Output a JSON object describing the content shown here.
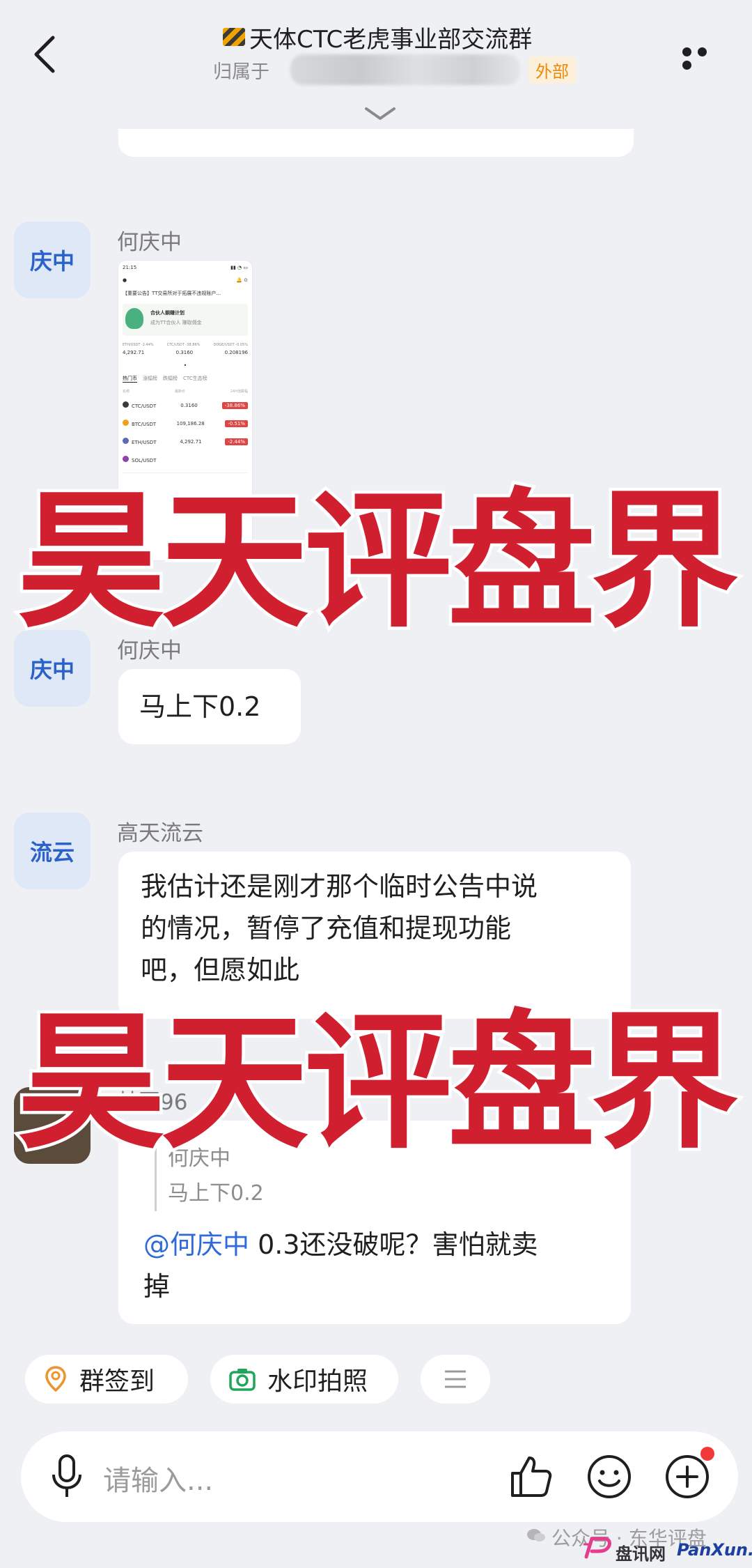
{
  "header": {
    "title": "天体CTC老虎事业部交流群",
    "belong_label": "归属于",
    "external_badge": "外部"
  },
  "messages": [
    {
      "avatar": "庆中",
      "sender": "何庆中",
      "type": "image"
    },
    {
      "avatar": "庆中",
      "sender": "何庆中",
      "text": "马上下0.2"
    },
    {
      "avatar": "流云",
      "sender": "高天流云",
      "lines": [
        "我估计还是刚才那个临时公告中说",
        "的情况，暂停了充值和提现功能",
        "吧，但愿如此"
      ]
    },
    {
      "sender": "林圆96",
      "quote_author": "何庆中",
      "quote_text": "马上下0.2",
      "mention": "@何庆中",
      "lines": [
        " 0.3还没破呢？害怕就卖",
        "掉"
      ]
    }
  ],
  "screenshot": {
    "time": "21:15",
    "notice": "【重要公告】TT交易所对于拓展不违规账户...",
    "banner_title": "合伙人躺赚计划",
    "banner_sub": "成为TT合伙人 赚取佣金",
    "tickers": [
      {
        "pair": "ETH/USDT -2.44%",
        "price": "4,292.71"
      },
      {
        "pair": "CTC/USDT -38.86%",
        "price": "0.3160"
      },
      {
        "pair": "DOGE/USDT -0.05%",
        "price": "0.208196"
      }
    ],
    "tabs": [
      "热门币",
      "涨幅榜",
      "跌幅榜",
      "CTC生态榜"
    ],
    "columns": [
      "名称",
      "最新价",
      "24H涨跌幅"
    ],
    "coins": [
      {
        "name": "CTC/USDT",
        "price": "0.3160",
        "change": "-38.86%",
        "color": "#3a3a3a"
      },
      {
        "name": "BTC/USDT",
        "price": "109,186.28",
        "change": "-0.51%",
        "color": "#f2a01c"
      },
      {
        "name": "ETH/USDT",
        "price": "4,292.71",
        "change": "-2.44%",
        "color": "#5b6bb5"
      },
      {
        "name": "SOL/USDT",
        "price": "",
        "change": "",
        "color": "#8e44ad"
      }
    ]
  },
  "watermark": "昊天评盘界",
  "quick_actions": [
    {
      "label": "群签到",
      "icon": "location-pin-icon"
    },
    {
      "label": "水印拍照",
      "icon": "camera-icon"
    },
    {
      "icon": "menu-icon"
    }
  ],
  "input": {
    "placeholder": "请输入..."
  },
  "footer": {
    "account": "公众号 · 东华评盘",
    "site": "盘讯网",
    "brand": "PanXun.cc"
  }
}
